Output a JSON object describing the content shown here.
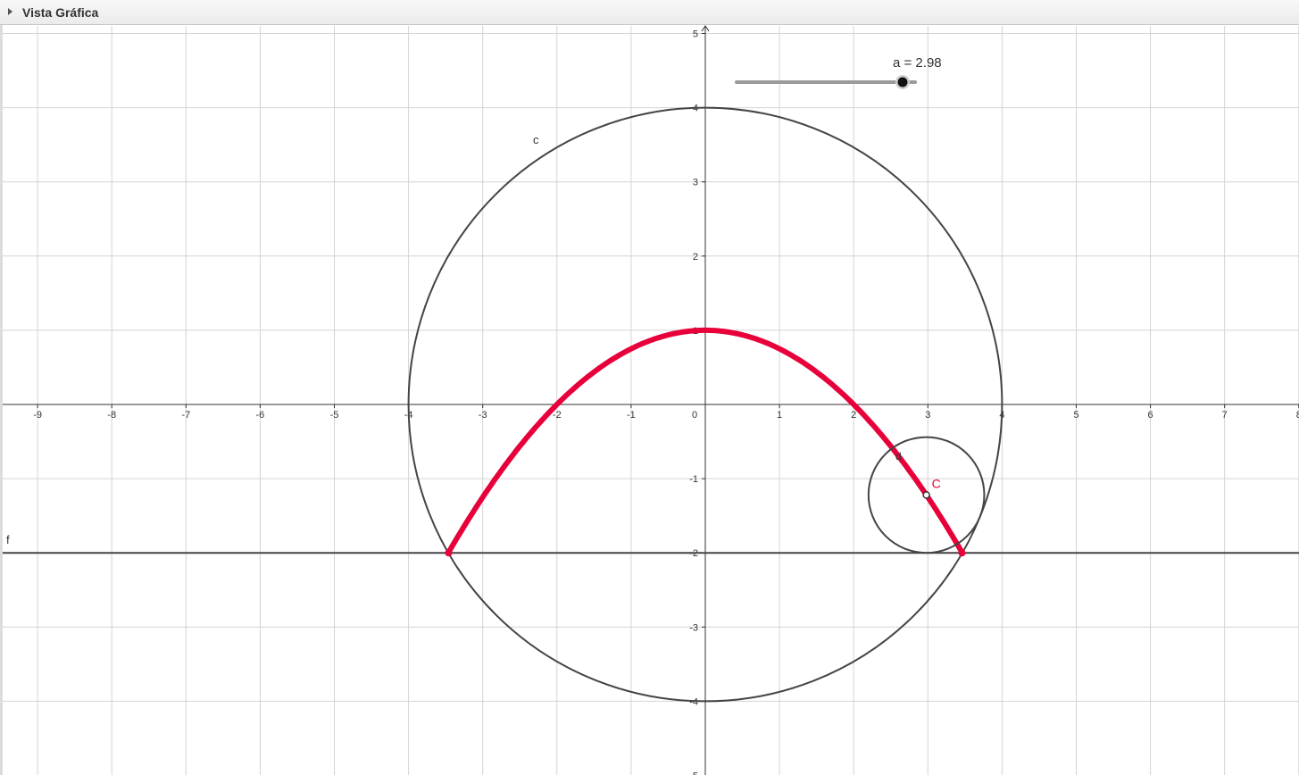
{
  "view": {
    "title": "Vista Gráfica"
  },
  "slider": {
    "label": "a = 2.98",
    "name": "a",
    "value": 2.98,
    "min": -4,
    "max": 4
  },
  "axes": {
    "x_ticks": [
      -9,
      -8,
      -7,
      -6,
      -5,
      -4,
      -3,
      -2,
      -1,
      0,
      1,
      2,
      3,
      4,
      5,
      6,
      7,
      8
    ],
    "y_ticks": [
      -5,
      -4,
      -3,
      -2,
      -1,
      1,
      2,
      3,
      4,
      5
    ],
    "grid": true
  },
  "objects": {
    "big_circle": {
      "label": "c",
      "center": [
        0,
        0
      ],
      "radius": 4
    },
    "line_f": {
      "label": "f",
      "y": -2
    },
    "small_circle": {
      "label": "d",
      "center": [
        2.98,
        -1.22
      ],
      "radius": 0.78
    },
    "point_C": {
      "label": "C",
      "x": 2.98,
      "y": -1.22
    },
    "locus": {
      "description": "y = 1 - x^2/4",
      "x_range": [
        -3.46,
        3.46
      ]
    }
  },
  "colors": {
    "locus": "#e8003a",
    "lines": "#444444",
    "grid": "#d4d4d4",
    "label_C": "#e8003a"
  },
  "icons": {
    "collapse": "triangle-right-icon"
  }
}
